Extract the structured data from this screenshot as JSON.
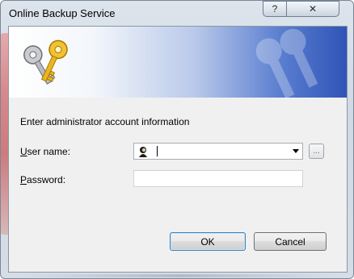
{
  "window": {
    "title": "Online Backup Service",
    "help_glyph": "?",
    "close_glyph": "✕"
  },
  "banner": {
    "icon": "keys-icon"
  },
  "form": {
    "prompt": "Enter administrator account information",
    "user_label_accel": "U",
    "user_label_rest": "ser name:",
    "user_value": "",
    "user_icon": "user-icon",
    "browse_label": "...",
    "password_label_accel": "P",
    "password_label_rest": "assword:",
    "password_value": ""
  },
  "buttons": {
    "ok": "OK",
    "cancel": "Cancel"
  }
}
